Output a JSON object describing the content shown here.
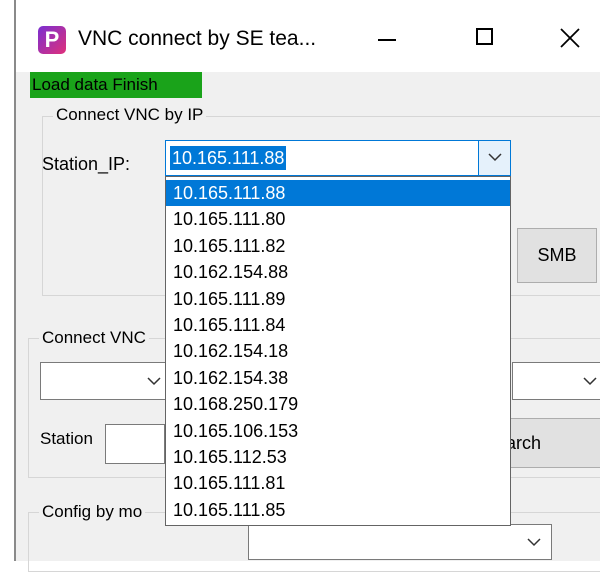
{
  "window": {
    "title": "VNC connect by SE tea...",
    "icon_letter": "P"
  },
  "status": {
    "text": "Load data Finish",
    "color": "#1aa31a"
  },
  "connect_by_ip": {
    "group_title": "Connect VNC by IP",
    "station_ip_label": "Station_IP:",
    "selected_ip": "10.165.111.88",
    "smb_label": "SMB",
    "options": [
      "10.165.111.88",
      "10.165.111.80",
      "10.165.111.82",
      "10.162.154.88",
      "10.165.111.89",
      "10.165.111.84",
      "10.162.154.18",
      "10.162.154.38",
      "10.168.250.179",
      "10.165.106.153",
      "10.165.112.53",
      "10.165.111.81",
      "10.165.111.85"
    ]
  },
  "connect_by_name": {
    "group_title": "Connect VNC",
    "station_label": "Station",
    "search_label": "arch"
  },
  "config_by_model": {
    "group_title": "Config by mo"
  },
  "colors": {
    "accent": "#0078d7",
    "window_bg": "#f0f0f0"
  }
}
